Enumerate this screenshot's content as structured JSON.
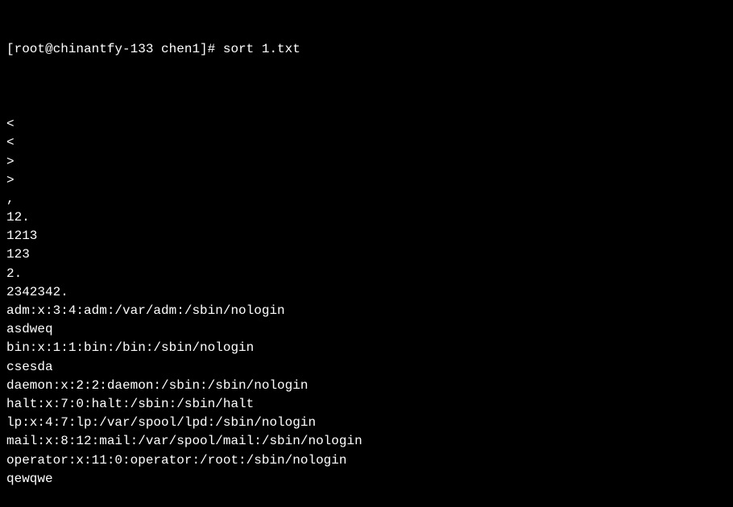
{
  "prompt": {
    "prefix": "[root@chinantfy-133 chen1]# ",
    "command": "sort 1.txt"
  },
  "output": [
    "",
    "<",
    "<",
    ">",
    ">",
    ",",
    "12.",
    "1213",
    "123",
    "2.",
    "2342342.",
    "adm:x:3:4:adm:/var/adm:/sbin/nologin",
    "asdweq",
    "bin:x:1:1:bin:/bin:/sbin/nologin",
    "csesda",
    "daemon:x:2:2:daemon:/sbin:/sbin/nologin",
    "halt:x:7:0:halt:/sbin:/sbin/halt",
    "lp:x:4:7:lp:/var/spool/lpd:/sbin/nologin",
    "mail:x:8:12:mail:/var/spool/mail:/sbin/nologin",
    "operator:x:11:0:operator:/root:/sbin/nologin",
    "qewqwe"
  ]
}
